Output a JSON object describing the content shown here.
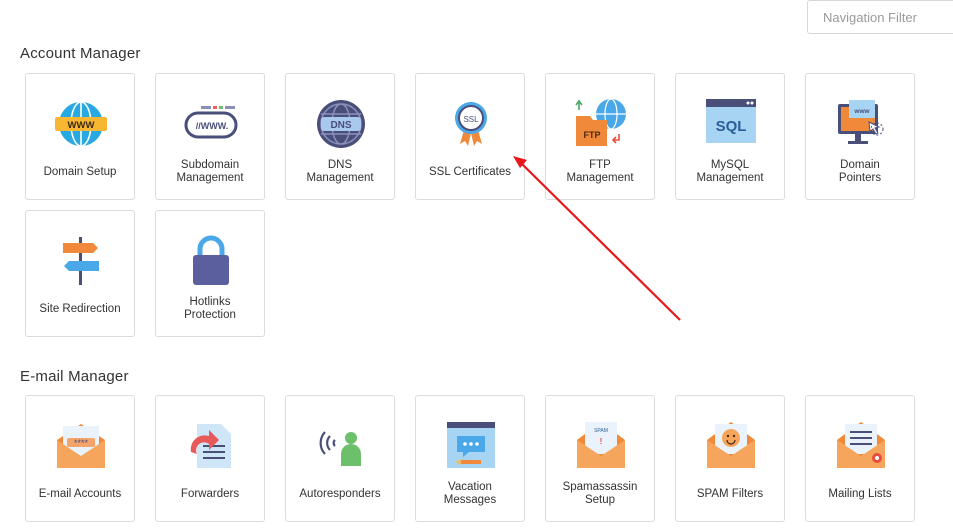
{
  "search": {
    "placeholder": "Navigation Filter"
  },
  "account_manager": {
    "title": "Account Manager",
    "items": [
      {
        "label": "Domain Setup",
        "icon": "globe-www-icon"
      },
      {
        "label": "Subdomain\nManagement",
        "icon": "www-link-icon"
      },
      {
        "label": "DNS\nManagement",
        "icon": "dns-globe-icon"
      },
      {
        "label": "SSL Certificates",
        "icon": "ssl-badge-icon"
      },
      {
        "label": "FTP\nManagement",
        "icon": "ftp-folder-icon"
      },
      {
        "label": "MySQL\nManagement",
        "icon": "sql-window-icon"
      },
      {
        "label": "Domain\nPointers",
        "icon": "monitor-pointer-icon"
      },
      {
        "label": "Site Redirection",
        "icon": "signpost-icon"
      },
      {
        "label": "Hotlinks\nProtection",
        "icon": "padlock-icon"
      }
    ]
  },
  "email_manager": {
    "title": "E-mail Manager",
    "items": [
      {
        "label": "E-mail Accounts",
        "icon": "envelope-password-icon"
      },
      {
        "label": "Forwarders",
        "icon": "forward-document-icon"
      },
      {
        "label": "Autoresponders",
        "icon": "person-signal-icon"
      },
      {
        "label": "Vacation\nMessages",
        "icon": "message-window-icon"
      },
      {
        "label": "Spamassassin\nSetup",
        "icon": "spam-envelope-icon"
      },
      {
        "label": "SPAM Filters",
        "icon": "smiley-envelope-icon"
      },
      {
        "label": "Mailing Lists",
        "icon": "list-envelope-icon"
      }
    ]
  },
  "annotation": {
    "color": "#e8171c"
  }
}
